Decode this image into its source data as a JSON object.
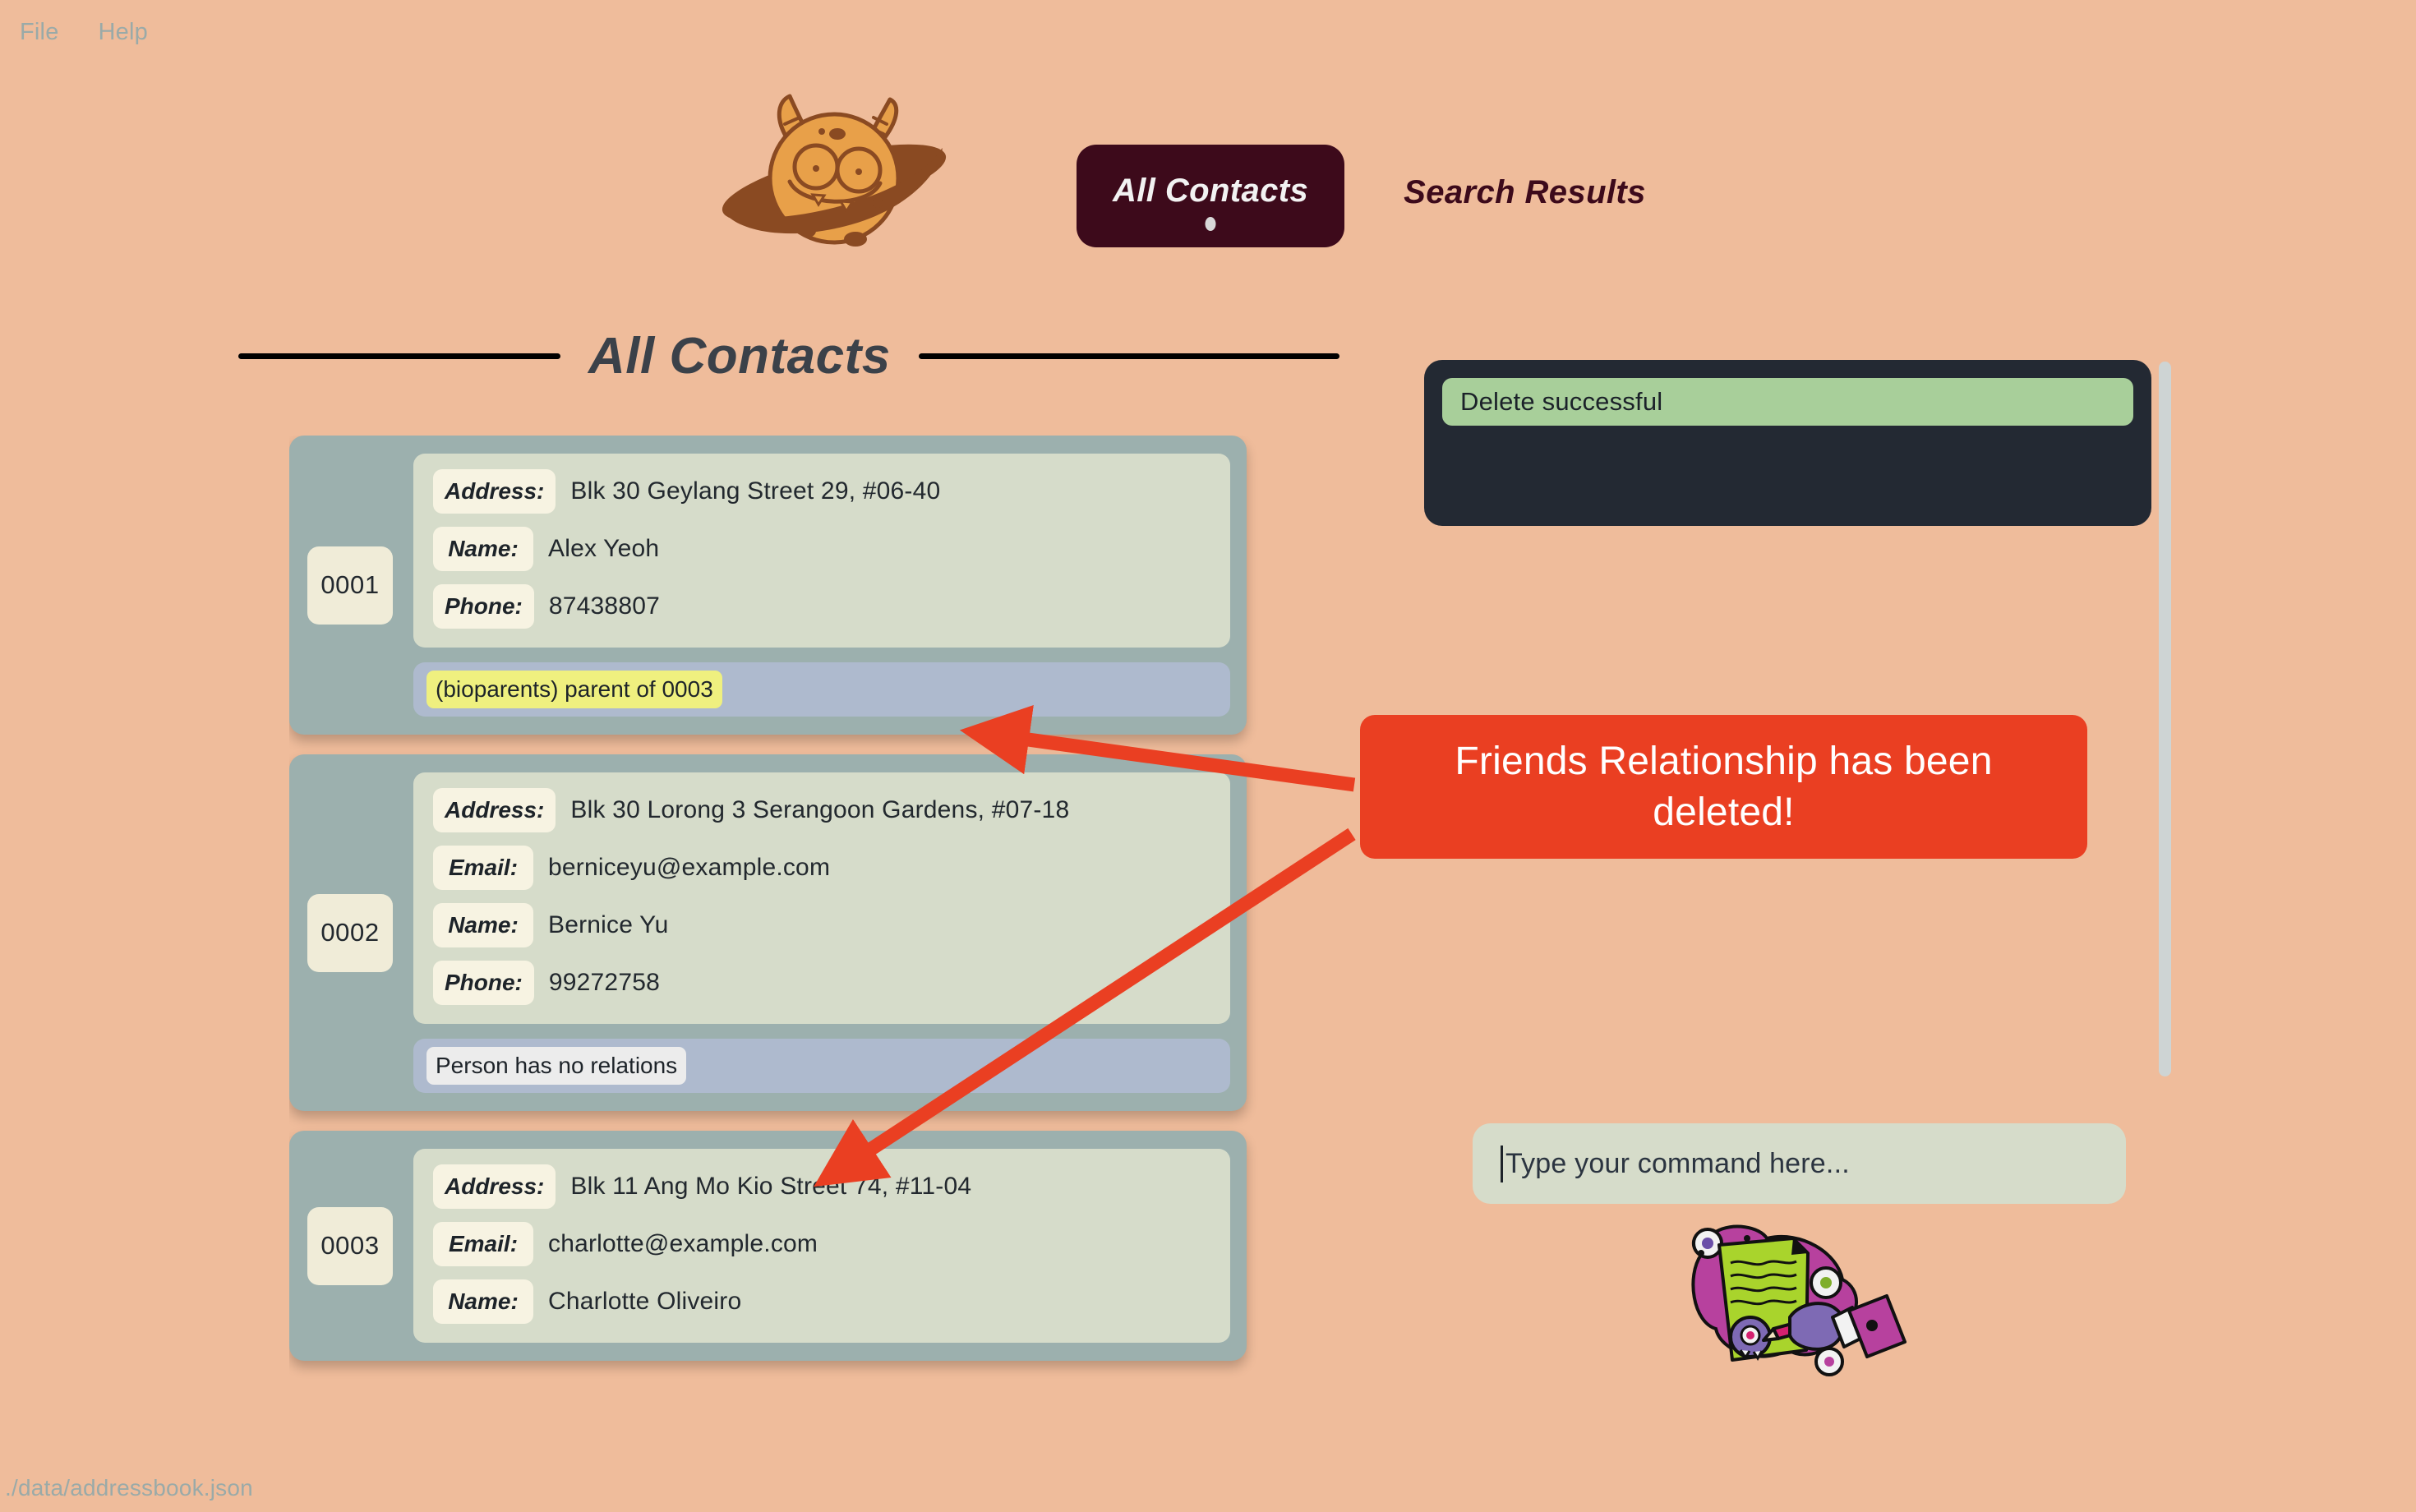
{
  "window": {
    "background_color": "#efbc9b",
    "menu": [
      {
        "label": "File"
      },
      {
        "label": "Help"
      }
    ]
  },
  "logo": {
    "icon": "monster-planet-icon",
    "body_color": "#e8a049",
    "outline_color": "#8a4a22"
  },
  "tabs": [
    {
      "label": "All Contacts",
      "active": true,
      "has_dot": true
    },
    {
      "label": "Search Results",
      "active": false,
      "has_dot": false
    }
  ],
  "section": {
    "title": "All Contacts"
  },
  "contacts": [
    {
      "id": "0001",
      "fields": [
        {
          "label": "Address:",
          "value": "Blk 30 Geylang Street 29, #06-40"
        },
        {
          "label": "Name:",
          "value": "Alex Yeoh"
        },
        {
          "label": "Phone:",
          "value": "87438807"
        }
      ],
      "relation": {
        "text": "(bioparents) parent of 0003",
        "style": "highlight"
      }
    },
    {
      "id": "0002",
      "fields": [
        {
          "label": "Address:",
          "value": "Blk 30 Lorong 3 Serangoon Gardens, #07-18"
        },
        {
          "label": "Email:",
          "value": "berniceyu@example.com"
        },
        {
          "label": "Name:",
          "value": "Bernice Yu"
        },
        {
          "label": "Phone:",
          "value": "99272758"
        }
      ],
      "relation": {
        "text": "Person has no relations",
        "style": "plain"
      }
    },
    {
      "id": "0003",
      "fields": [
        {
          "label": "Address:",
          "value": "Blk 11 Ang Mo Kio Street 74, #11-04"
        },
        {
          "label": "Email:",
          "value": "charlotte@example.com"
        },
        {
          "label": "Name:",
          "value": "Charlotte Oliveiro"
        }
      ],
      "relation": null
    }
  ],
  "result_panel": {
    "message": "Delete successful",
    "message_color": "#a8cf9a",
    "panel_color": "#232933"
  },
  "command_box": {
    "placeholder": "Type your command here...",
    "value": ""
  },
  "decoration": {
    "icon": "monster-hand-writing-notepad-icon"
  },
  "annotation": {
    "text": "Friends Relationship has been deleted!",
    "color": "#ea3f22",
    "arrow_count": 2
  },
  "statusbar": {
    "path": "./data/addressbook.json"
  }
}
